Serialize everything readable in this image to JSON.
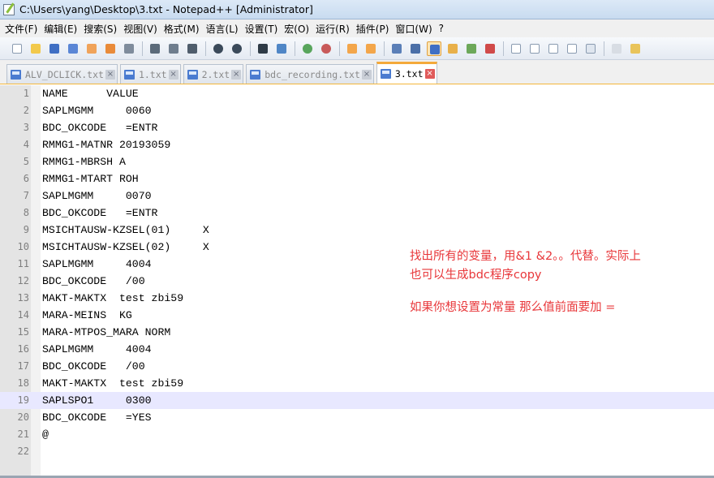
{
  "window": {
    "title": "C:\\Users\\yang\\Desktop\\3.txt - Notepad++ [Administrator]"
  },
  "menu": [
    "文件(F)",
    "编辑(E)",
    "搜索(S)",
    "视图(V)",
    "格式(M)",
    "语言(L)",
    "设置(T)",
    "宏(O)",
    "运行(R)",
    "插件(P)",
    "窗口(W)",
    "?"
  ],
  "tabs": [
    {
      "label": "ALV_DCLICK.txt",
      "active": false
    },
    {
      "label": "1.txt",
      "active": false
    },
    {
      "label": "2.txt",
      "active": false
    },
    {
      "label": "bdc_recording.txt",
      "active": false
    },
    {
      "label": "3.txt",
      "active": true
    }
  ],
  "editor": {
    "current_line": 19,
    "lines": [
      {
        "n": "1",
        "text": "NAME      VALUE"
      },
      {
        "n": "2",
        "text": "SAPLMGMM     0060"
      },
      {
        "n": "3",
        "text": "BDC_OKCODE   =ENTR"
      },
      {
        "n": "4",
        "text": "RMMG1-MATNR 20193059"
      },
      {
        "n": "5",
        "text": "RMMG1-MBRSH A"
      },
      {
        "n": "6",
        "text": "RMMG1-MTART ROH"
      },
      {
        "n": "7",
        "text": "SAPLMGMM     0070"
      },
      {
        "n": "8",
        "text": "BDC_OKCODE   =ENTR"
      },
      {
        "n": "9",
        "text": "MSICHTAUSW-KZSEL(01)     X"
      },
      {
        "n": "10",
        "text": "MSICHTAUSW-KZSEL(02)     X"
      },
      {
        "n": "11",
        "text": "SAPLMGMM     4004"
      },
      {
        "n": "12",
        "text": "BDC_OKCODE   /00"
      },
      {
        "n": "13",
        "text": "MAKT-MAKTX  test zbi59"
      },
      {
        "n": "14",
        "text": "MARA-MEINS  KG"
      },
      {
        "n": "15",
        "text": "MARA-MTPOS_MARA NORM"
      },
      {
        "n": "16",
        "text": "SAPLMGMM     4004"
      },
      {
        "n": "17",
        "text": "BDC_OKCODE   /00"
      },
      {
        "n": "18",
        "text": "MAKT-MAKTX  test zbi59"
      },
      {
        "n": "19",
        "text": "SAPLSPO1     0300"
      },
      {
        "n": "20",
        "text": "BDC_OKCODE   =YES"
      },
      {
        "n": "21",
        "text": "@"
      },
      {
        "n": "22",
        "text": ""
      }
    ]
  },
  "annotations": {
    "note1_line1": "找出所有的变量，用&1 &2。。代替。实际上",
    "note1_line2": "也可以生成bdc程序copy",
    "note2": "如果你想设置为常量 那么值前面要加 ="
  },
  "toolbar_icons": [
    "new-file-icon",
    "open-file-icon",
    "save-icon",
    "save-all-icon",
    "close-icon",
    "close-all-icon",
    "print-icon",
    "cut-icon",
    "copy-icon",
    "paste-icon",
    "undo-icon",
    "redo-icon",
    "find-icon",
    "replace-icon",
    "zoom-in-icon",
    "zoom-out-icon",
    "sync-v-icon",
    "sync-h-icon",
    "word-wrap-icon",
    "all-chars-icon",
    "indent-guide-icon",
    "doc-map-icon",
    "folder-workspace-icon",
    "function-list-icon",
    "macro-record-icon",
    "macro-stop-icon",
    "macro-play-icon",
    "macro-run-multiple-icon",
    "macro-save-icon",
    "spell-check-icon",
    "spell-options-icon"
  ],
  "colors": {
    "annotation": "#e8373a",
    "current_line": "#e8e8ff",
    "active_tab_accent": "#f4a93a"
  }
}
